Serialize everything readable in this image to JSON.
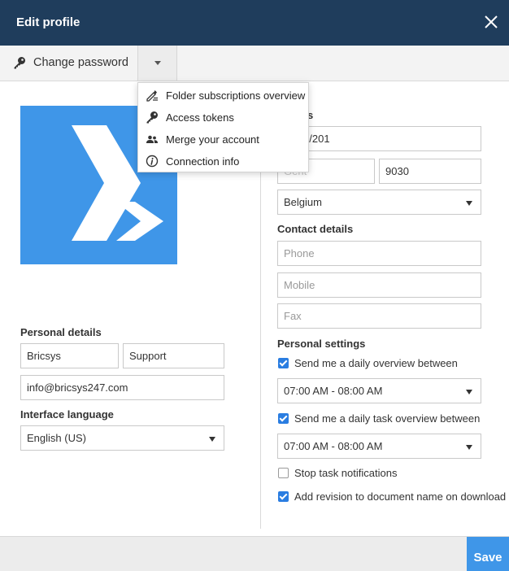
{
  "header": {
    "title": "Edit profile",
    "close_icon": "close-icon"
  },
  "toolbar": {
    "change_password_label": "Change password",
    "key_icon": "key-icon",
    "dropdown_icon": "chevron-down-icon"
  },
  "menu": {
    "items": [
      {
        "label": "Folder subscriptions overview",
        "icon": "folder-subscriptions-icon"
      },
      {
        "label": "Access tokens",
        "icon": "key-icon"
      },
      {
        "label": "Merge your account",
        "icon": "users-icon"
      },
      {
        "label": "Connection info",
        "icon": "info-icon"
      }
    ]
  },
  "address": {
    "label_partial": "s",
    "street_partial": "ue 5/201",
    "city_partial": "Gent",
    "zip": "9030",
    "country": "Belgium"
  },
  "personal": {
    "label": "Personal details",
    "first_name": "Bricsys",
    "last_name": "Support",
    "email": "info@bricsys247.com"
  },
  "interface_language": {
    "label": "Interface language",
    "value": "English (US)"
  },
  "contact": {
    "label": "Contact details",
    "phone_placeholder": "Phone",
    "mobile_placeholder": "Mobile",
    "fax_placeholder": "Fax"
  },
  "settings": {
    "label": "Personal settings",
    "daily_overview": {
      "label": "Send me a daily overview between",
      "checked": true,
      "time": "07:00 AM - 08:00 AM"
    },
    "daily_task_overview": {
      "label": "Send me a daily task overview between",
      "checked": true,
      "time": "07:00 AM - 08:00 AM"
    },
    "stop_notifications": {
      "label": "Stop task notifications",
      "checked": false
    },
    "add_revision": {
      "label": "Add revision to document name on download",
      "checked": true
    }
  },
  "footer": {
    "save_label": "Save"
  },
  "colors": {
    "header_bg": "#1f3d5c",
    "accent": "#3f96e8",
    "checkbox": "#2a7de1"
  }
}
